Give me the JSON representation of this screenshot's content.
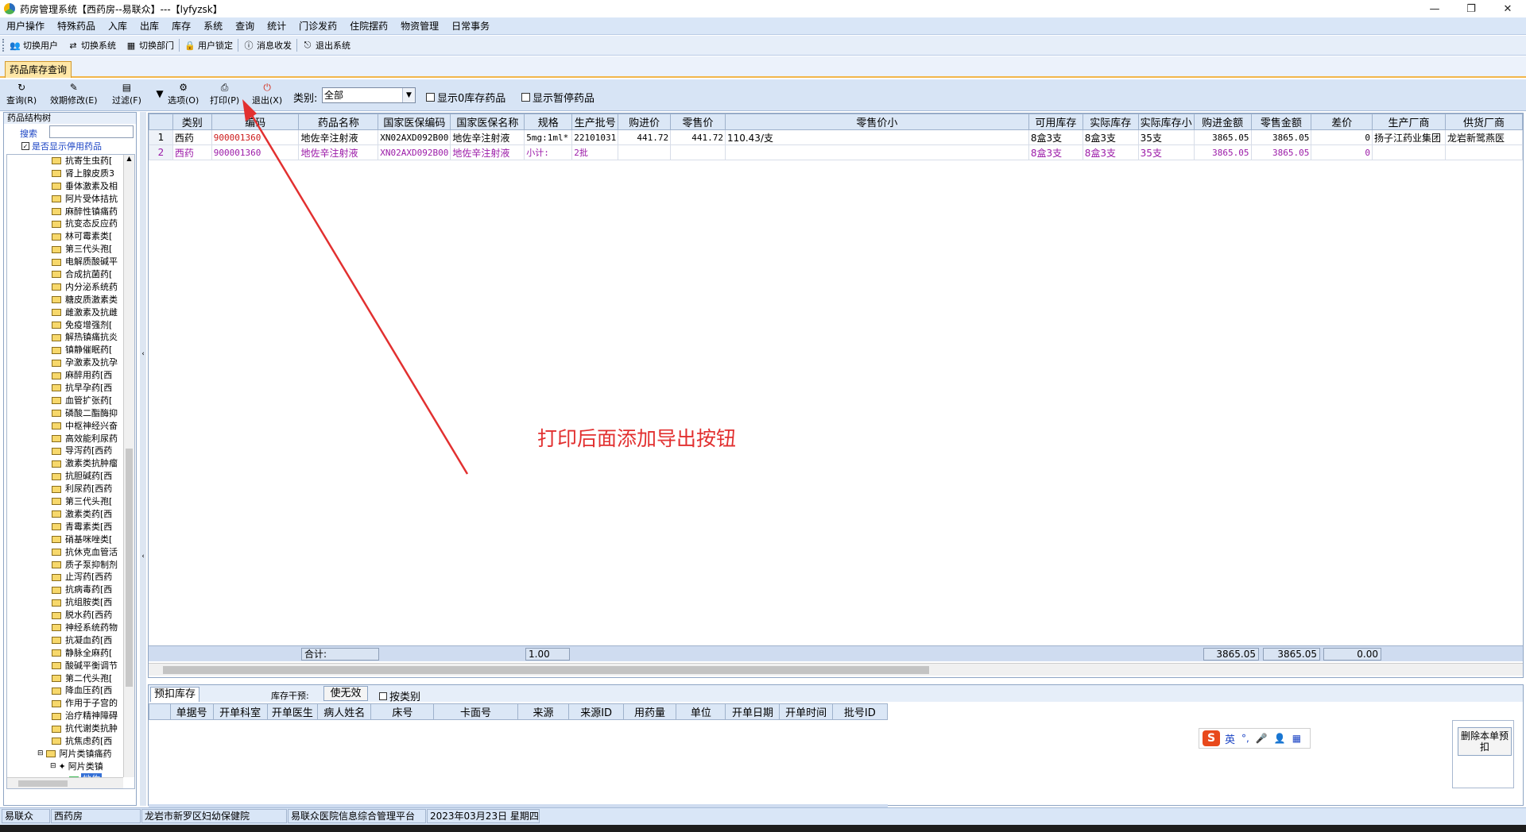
{
  "window": {
    "title": "药房管理系统【西药房--易联众】---【lyfyzsk】",
    "controls": [
      "—",
      "❐",
      "✕"
    ]
  },
  "menu": [
    "用户操作",
    "特殊药品",
    "入库",
    "出库",
    "库存",
    "系统",
    "查询",
    "统计",
    "门诊发药",
    "住院摆药",
    "物资管理",
    "日常事务"
  ],
  "toolbar": [
    "切换用户",
    "切换系统",
    "切换部门",
    "用户锁定",
    "消息收发",
    "退出系统"
  ],
  "doc_tab": "药品库存查询",
  "functions": {
    "query": "查询(R)",
    "expiry": "效期修改(E)",
    "filter": "过滤(F)",
    "options": "选项(O)",
    "print": "打印(P)",
    "exit": "退出(X)",
    "category_label": "类别:",
    "category_value": "全部",
    "show_zero": "显示0库存药品",
    "show_suspended": "显示暂停药品"
  },
  "left_panel": {
    "title": "药品结构树",
    "search_label": "搜索",
    "show_disabled": "是否显示停用药品",
    "tree_items": [
      "抗寄生虫药[",
      "肾上腺皮质3",
      "垂体激素及相",
      "阿片受体拮抗",
      "麻醉性镇痛药",
      "抗变态反应药",
      "林可霉素类[",
      "第三代头孢[",
      "电解质酸碱平",
      "合成抗菌药[",
      "内分泌系统药",
      "糖皮质激素类",
      "雌激素及抗雌",
      "免疫增强剂[",
      "解热镇痛抗炎",
      "镇静催眠药[",
      "孕激素及抗孕",
      "麻醉用药[西",
      "抗早孕药[西",
      "血管扩张药[",
      "磷酸二酯酶抑",
      "中枢神经兴奋",
      "高效能利尿药",
      "导泻药[西药",
      "激素类抗肿瘤",
      "抗胆碱药[西",
      "利尿药[西药",
      "第三代头孢[",
      "激素类药[西",
      "青霉素类[西",
      "硝基咪唑类[",
      "抗休克血管活",
      "质子泵抑制剂",
      "止泻药[西药",
      "抗病毒药[西",
      "抗组胺类[西",
      "脱水药[西药",
      "神经系统药物",
      "抗凝血药[西",
      "静脉全麻药[",
      "酸碱平衡调节",
      "第二代头孢[",
      "降血压药[西",
      "作用于子宫的",
      "治疗精神障碍",
      "抗代谢类抗肿",
      "抗焦虑药[西"
    ],
    "tree_parent": "阿片类镇痛药",
    "tree_child": "阿片类镇",
    "tree_leaf": "地佐"
  },
  "grid": {
    "columns": [
      "",
      "类别",
      "编码",
      "药品名称",
      "国家医保编码",
      "国家医保名称",
      "规格",
      "生产批号",
      "购进价",
      "零售价",
      "零售价小",
      "可用库存",
      "实际库存",
      "实际库存小",
      "购进金额",
      "零售金额",
      "差价",
      "生产厂商",
      "供货厂商"
    ],
    "rows": [
      [
        "1",
        "西药",
        "900001360",
        "地佐辛注射液",
        "XN02AXD092B00",
        "地佐辛注射液",
        "5mg:1ml*",
        "22101031",
        "441.72",
        "441.72",
        "110.43/支",
        "8盒3支",
        "8盒3支",
        "35支",
        "3865.05",
        "3865.05",
        "0",
        "扬子江药业集团",
        "龙岩新鹭燕医"
      ],
      [
        "2",
        "西药",
        "900001360",
        "地佐辛注射液",
        "XN02AXD092B00",
        "地佐辛注射液",
        "小计:",
        "2批",
        "",
        "",
        "",
        "8盒3支",
        "8盒3支",
        "35支",
        "3865.05",
        "3865.05",
        "0",
        "",
        ""
      ]
    ],
    "sum_label": "合计:",
    "sum_spec": "1.00",
    "sum_purchase": "3865.05",
    "sum_retail": "3865.05",
    "sum_diff": "0.00"
  },
  "annotation": "打印后面添加导出按钮",
  "bottom": {
    "tab": "预扣库存",
    "intervene_label": "库存干预:",
    "invalidate": "使无效",
    "by_category": "按类别",
    "columns": [
      "",
      "单据号",
      "开单科室",
      "开单医生",
      "病人姓名",
      "床号",
      "卡面号",
      "来源",
      "来源ID",
      "用药量",
      "单位",
      "开单日期",
      "开单时间",
      "批号ID"
    ],
    "delete_button": "删除本单预扣",
    "ime_mode": "英"
  },
  "status": [
    "易联众",
    "西药房",
    "龙岩市新罗区妇幼保健院",
    "易联众医院信息综合管理平台",
    "2023年03月23日 星期四"
  ],
  "colors": {
    "accent": "#d9e6f7",
    "annotation": "#e23030",
    "subtotal": "#9b1aa8"
  }
}
